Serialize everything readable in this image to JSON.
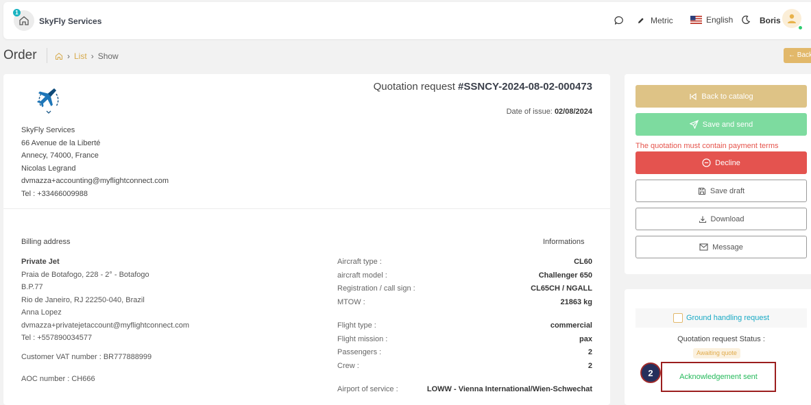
{
  "topbar": {
    "notification_count": "1",
    "brand": "SkyFly Services",
    "units_label": "Metric",
    "language_label": "English",
    "user_name": "Boris"
  },
  "page": {
    "title": "Order",
    "breadcrumb": [
      "List",
      "Show"
    ],
    "back_label": "← Back"
  },
  "quotation": {
    "title_prefix": "Quotation request",
    "number": "#SSNCY-2024-08-02-000473",
    "date_label": "Date of issue:",
    "date_value": "02/08/2024"
  },
  "company": {
    "name": "SkyFly Services",
    "lines": [
      "66 Avenue de la Liberté",
      "Annecy,  74000,  France",
      "Nicolas Legrand",
      "dvmazza+accounting@myflightconnect.com",
      "Tel : +33466009988"
    ]
  },
  "billing": {
    "heading": "Billing address",
    "name": "Private Jet",
    "lines": [
      "Praia de Botafogo, 228 - 2° - Botafogo",
      "B.P.77",
      "Rio de Janeiro,  RJ 22250-040,  Brazil",
      "Anna Lopez",
      "dvmazza+privatejetaccount@myflightconnect.com",
      "Tel : +557890034577"
    ],
    "vat": "Customer VAT number : BR777888999",
    "aoc": "AOC number : CH666"
  },
  "informations": {
    "heading": "Informations",
    "rows": [
      {
        "label": "Aircraft type :",
        "value": "CL60"
      },
      {
        "label": "aircraft model :",
        "value": "Challenger 650"
      },
      {
        "label": "Registration / call sign :",
        "value": "CL65CH / NGALL"
      },
      {
        "label": "MTOW :",
        "value": "21863 kg"
      },
      {
        "label": "Flight type :",
        "value": "commercial"
      },
      {
        "label": "Flight mission :",
        "value": "pax"
      },
      {
        "label": "Passengers :",
        "value": "2"
      },
      {
        "label": "Crew :",
        "value": "2"
      },
      {
        "label": "Airport of service :",
        "value": "LOWW - Vienna International/Wien-Schwechat"
      }
    ]
  },
  "actions": {
    "back_to_catalog": "Back to catalog",
    "save_and_send": "Save and send",
    "warning": "The quotation must contain payment terms",
    "decline": "Decline",
    "save_draft": "Save draft",
    "download": "Download",
    "message": "Message"
  },
  "status_panel": {
    "ground_handling": "Ground handling request",
    "status_label": "Quotation request Status :",
    "status_badge": "Awaiting quote",
    "acknowledgement": "Acknowledgement sent",
    "step_number": "2"
  },
  "colors": {
    "accent_gold": "#dec386",
    "success_green": "#7ddb9f",
    "danger_red": "#e4534f",
    "link_teal": "#17a9c4"
  }
}
